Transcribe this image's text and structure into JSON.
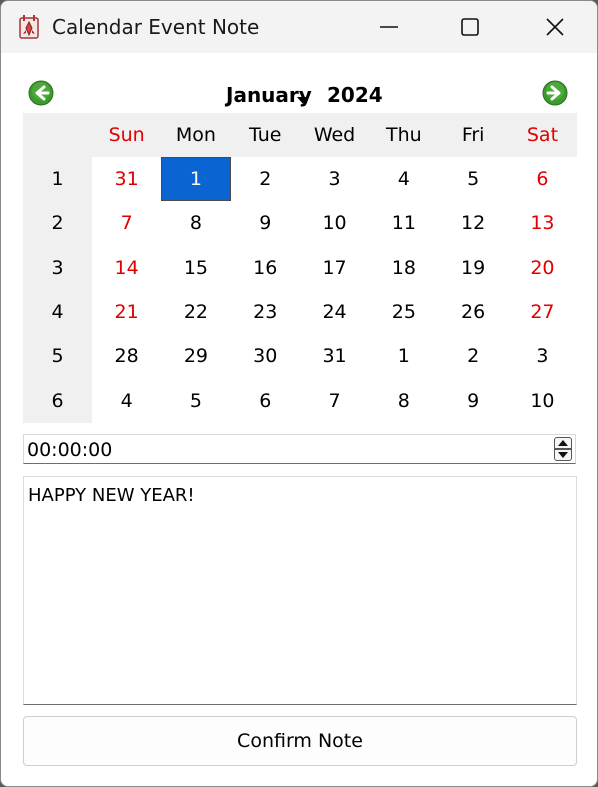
{
  "window": {
    "title": "Calendar Event Note",
    "app_icon": "calendar-rocket-icon",
    "controls": [
      "minimize-icon",
      "maximize-icon",
      "close-icon"
    ]
  },
  "calendar": {
    "nav": {
      "prev_icon": "arrow-left-circle-icon",
      "next_icon": "arrow-right-circle-icon"
    },
    "month": "January",
    "year": "2024",
    "weekdays": [
      "Sun",
      "Mon",
      "Tue",
      "Wed",
      "Thu",
      "Fri",
      "Sat"
    ],
    "weekend_color": "#e00000",
    "selection_color": "#0a64d2",
    "selected": {
      "row": 0,
      "col": 1
    },
    "weeks": [
      {
        "number": "1",
        "days": [
          "31",
          "1",
          "2",
          "3",
          "4",
          "5",
          "6"
        ]
      },
      {
        "number": "2",
        "days": [
          "7",
          "8",
          "9",
          "10",
          "11",
          "12",
          "13"
        ]
      },
      {
        "number": "3",
        "days": [
          "14",
          "15",
          "16",
          "17",
          "18",
          "19",
          "20"
        ]
      },
      {
        "number": "4",
        "days": [
          "21",
          "22",
          "23",
          "24",
          "25",
          "26",
          "27"
        ]
      },
      {
        "number": "5",
        "days": [
          "28",
          "29",
          "30",
          "31",
          "1",
          "2",
          "3"
        ]
      },
      {
        "number": "6",
        "days": [
          "4",
          "5",
          "6",
          "7",
          "8",
          "9",
          "10"
        ]
      }
    ]
  },
  "time_edit": {
    "value": "00:00:00"
  },
  "note": {
    "text": "HAPPY NEW YEAR!"
  },
  "confirm_button": {
    "label": "Confirm Note"
  }
}
